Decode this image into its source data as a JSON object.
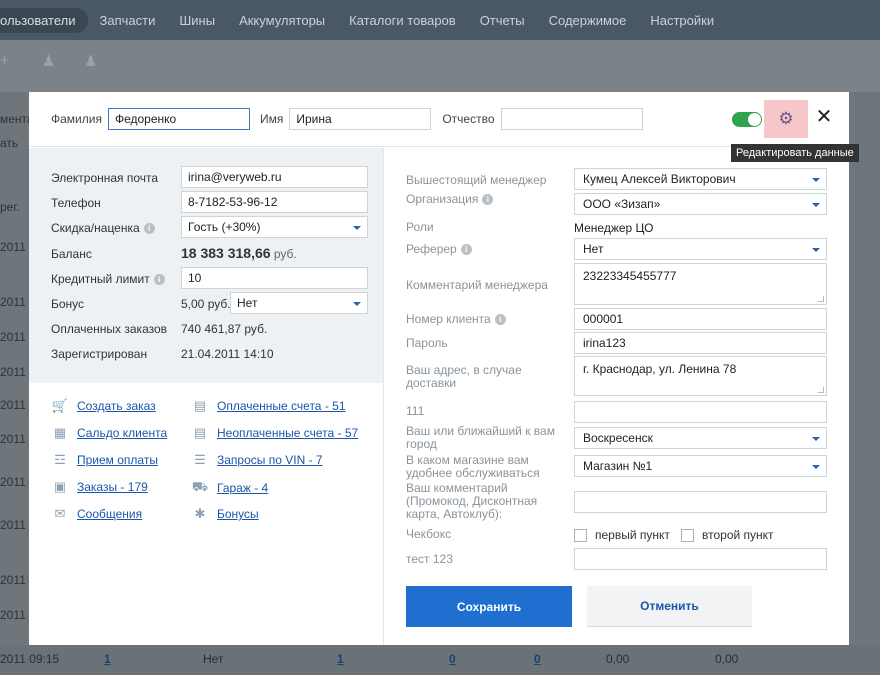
{
  "nav": {
    "items": [
      "ользователи",
      "Запчасти",
      "Шины",
      "Аккумуляторы",
      "Каталоги товаров",
      "Отчеты",
      "Содержимое",
      "Настройки"
    ]
  },
  "background": {
    "side_labels": [
      "мента",
      "ать",
      "рег.",
      "2011",
      "2011",
      "2011",
      "2011",
      "2011",
      "2011",
      "2011",
      "2011",
      "2011",
      "2011",
      "2011",
      "2011"
    ],
    "bottom_row": {
      "date": "2011 09:15",
      "c1": "1",
      "c2": "Нет",
      "c3": "1",
      "c4": "0",
      "c5": "0",
      "c6": "0,00",
      "c7": "0,00"
    }
  },
  "modal": {
    "header": {
      "last_name_label": "Фамилия",
      "last_name_value": "Федоренко",
      "first_name_label": "Имя",
      "first_name_value": "Ирина",
      "patronymic_label": "Отчество",
      "patronymic_value": "",
      "tooltip": "Редактировать данные"
    },
    "left": {
      "email_label": "Электронная почта",
      "email_value": "irina@veryweb.ru",
      "phone_label": "Телефон",
      "phone_value": "8-7182-53-96-12",
      "discount_label": "Скидка/наценка",
      "discount_value": "Гость (+30%)",
      "balance_label": "Баланс",
      "balance_value": "18 383 318,66",
      "balance_unit": "руб.",
      "credit_label": "Кредитный лимит",
      "credit_value": "10",
      "bonus_label": "Бонус",
      "bonus_value": "5,00 руб.",
      "bonus_select": "Нет",
      "paid_orders_label": "Оплаченных заказов",
      "paid_orders_value": "740 461,87 руб.",
      "registered_label": "Зарегистрирован",
      "registered_value": "21.04.2011 14:10"
    },
    "links": {
      "create_order": "Создать заказ",
      "paid_invoices": "Оплаченные счета - 51",
      "client_saldo": "Сальдо клиента",
      "unpaid_invoices": "Неоплаченные счета - 57",
      "payment_receive": "Прием оплаты",
      "vin_requests": "Запросы по VIN - 7",
      "orders": "Заказы - 179",
      "garage": "Гараж - 4",
      "messages": "Сообщения",
      "bonuses": "Бонусы"
    },
    "right": {
      "manager_label": "Вышестоящий менеджер",
      "manager_value": "Кумец Алексей Викторович",
      "org_label": "Организация",
      "org_value": "ООО «Зизап»",
      "roles_label": "Роли",
      "roles_value": "Менеджер ЦО",
      "referrer_label": "Реферер",
      "referrer_value": "Нет",
      "manager_comment_label": "Комментарий менеджера",
      "manager_comment_value": "23223345455777",
      "client_number_label": "Номер клиента",
      "client_number_value": "000001",
      "password_label": "Пароль",
      "password_value": "irina123",
      "address_label": "Ваш адрес, в случае доставки",
      "address_value": "г. Краснодар, ул. Ленина 78",
      "field111_label": "111",
      "field111_value": "",
      "city_label": "Ваш или ближайший к вам город",
      "city_value": "Воскресенск",
      "store_label": "В каком магазине вам удобнее обслуживаться",
      "store_value": "Магазин №1",
      "your_comment_label": "Ваш комментарий (Промокод, Дисконтная карта, Автоклуб):",
      "your_comment_value": "",
      "checkbox_label": "Чекбокс",
      "checkbox_opt1": "первый пункт",
      "checkbox_opt2": "второй пункт",
      "test_label": "тест 123",
      "test_value": ""
    },
    "buttons": {
      "save": "Сохранить",
      "cancel": "Отменить"
    }
  }
}
